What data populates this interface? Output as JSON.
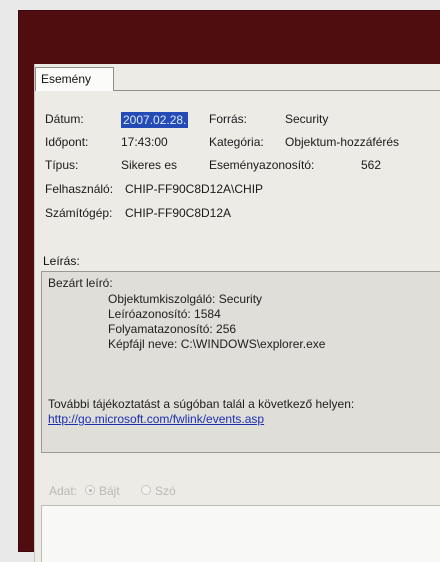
{
  "tab": {
    "label": "Esemény"
  },
  "fields": {
    "date": {
      "label": "Dátum:",
      "value": "2007.02.28."
    },
    "source": {
      "label": "Forrás:",
      "value": "Security"
    },
    "time": {
      "label": "Időpont:",
      "value": "17:43:00"
    },
    "category": {
      "label": "Kategória:",
      "value": "Objektum-hozzáférés"
    },
    "type": {
      "label": "Típus:",
      "value": "Sikeres es"
    },
    "event_id": {
      "label": "Eseményazonosító:",
      "value": "562"
    },
    "user": {
      "label": "Felhasználó:",
      "value": "CHIP-FF90C8D12A\\CHIP"
    },
    "computer": {
      "label": "Számítógép:",
      "value": "CHIP-FF90C8D12A"
    }
  },
  "description": {
    "label": "Leírás:",
    "lines": [
      "Bezárt leíró:",
      "Objektumkiszolgáló: Security",
      "Leíróazonosító:      1584",
      "Folyamatazonosító:  256",
      "Képfájl neve:          C:\\WINDOWS\\explorer.exe",
      "További tájékoztatást a súgóban talál a következő helyen:",
      "http://go.microsoft.com/fwlink/events.asp"
    ]
  },
  "data": {
    "label": "Adat:",
    "options": [
      "Bájt",
      "Szó"
    ]
  },
  "colors": {
    "frame": "#4f0d10",
    "selection": "#244bb5",
    "link": "#1a2fb0"
  }
}
